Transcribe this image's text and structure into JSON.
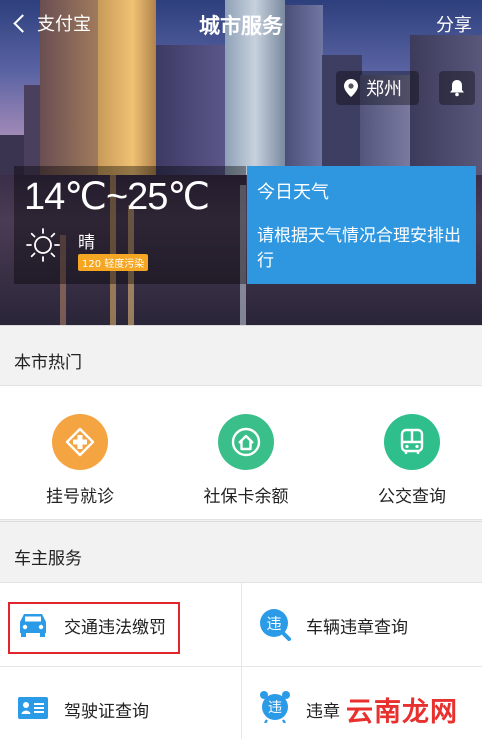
{
  "topbar": {
    "back_label": "支付宝",
    "title": "城市服务",
    "share_label": "分享"
  },
  "city": {
    "name": "郑州"
  },
  "weather": {
    "temp_range": "14℃~25℃",
    "condition": "晴",
    "aqi_text": "120 轻度污染",
    "card_title": "今日天气",
    "card_text": "请根据天气情况合理安排出行"
  },
  "hot": {
    "header": "本市热门",
    "items": [
      {
        "label": "挂号就诊",
        "icon": "medical-cross-icon",
        "color": "#f5a442"
      },
      {
        "label": "社保卡余额",
        "icon": "social-security-icon",
        "color": "#3bbf8a"
      },
      {
        "label": "公交查询",
        "icon": "bus-icon",
        "color": "#2fbf8c"
      }
    ]
  },
  "car": {
    "header": "车主服务",
    "items": [
      {
        "label": "交通违法缴罚",
        "icon": "car-icon",
        "color": "#2b9be8"
      },
      {
        "label": "车辆违章查询",
        "icon": "violation-search-icon",
        "color": "#2b9be8"
      },
      {
        "label": "驾驶证查询",
        "icon": "license-card-icon",
        "color": "#2b9be8"
      },
      {
        "label": "违章",
        "icon": "violation-alarm-icon",
        "color": "#2b9be8"
      }
    ]
  },
  "watermark": {
    "text": "云南龙网"
  }
}
